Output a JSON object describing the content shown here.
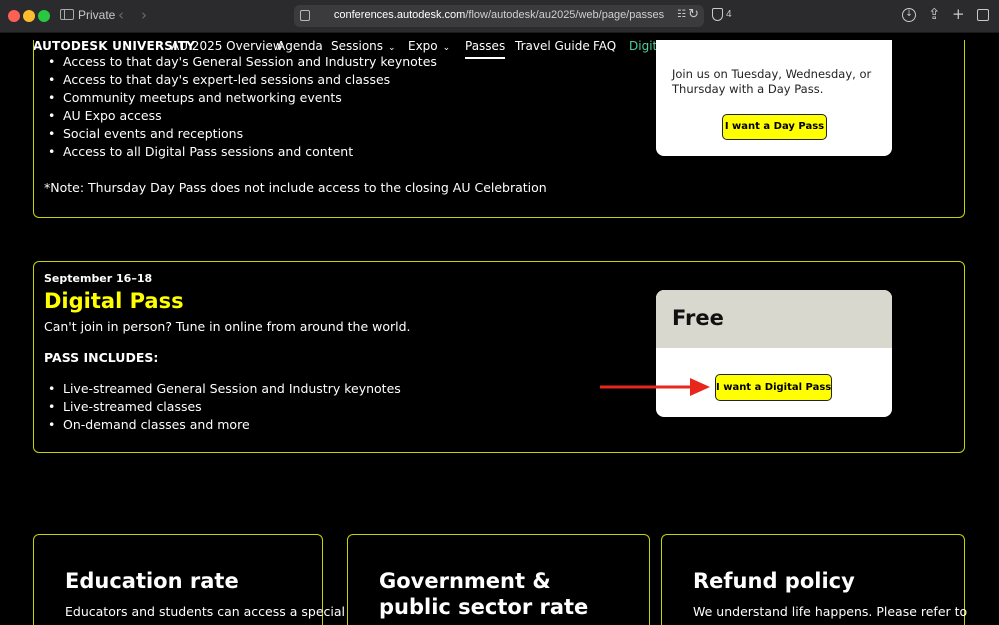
{
  "browser": {
    "private_label": "Private",
    "url_domain": "conferences.autodesk.com",
    "url_path": "/flow/autodesk/au2025/web/page/passes",
    "shield_count": "4"
  },
  "nav": {
    "brand": "AUTODESK UNIVERSITY",
    "items": [
      {
        "label": "AU 2025 Overview"
      },
      {
        "label": "Agenda"
      },
      {
        "label": "Sessions"
      },
      {
        "label": "Expo"
      },
      {
        "label": "Passes"
      },
      {
        "label": "Travel Guide"
      },
      {
        "label": "FAQ"
      },
      {
        "label": "Digital"
      }
    ],
    "chevron": "⌄",
    "active_color": "#ffffff",
    "digital_color": "#4fcf98"
  },
  "day_pass": {
    "bullets": [
      "Access to that day's General Session and Industry keynotes",
      "Access to that day's expert-led sessions and classes",
      "Community meetups and networking events",
      "AU Expo access",
      "Social events and receptions",
      "Access to all Digital Pass sessions and content"
    ],
    "note": "*Note: Thursday Day Pass does not include access to the closing AU Celebration",
    "card_text": "Join us on Tuesday, Wednesday, or Thursday with a Day Pass.",
    "button": "I want a Day Pass"
  },
  "digital_pass": {
    "dates": "September 16–18",
    "title": "Digital Pass",
    "subtitle": "Can't join in person? Tune in online from around the world.",
    "includes_label": "PASS INCLUDES:",
    "bullets": [
      "Live-streamed General Session and Industry keynotes",
      "Live-streamed classes",
      "On-demand classes and more"
    ],
    "price": "Free",
    "button": "I want a Digital Pass"
  },
  "bottom_cards": [
    {
      "title": "Education rate",
      "text": "Educators and students can access a special"
    },
    {
      "title": "Government & public sector rate",
      "text": ""
    },
    {
      "title": "Refund policy",
      "text": "We understand life happens. Please refer to"
    }
  ],
  "colors": {
    "accent_yellow": "#ffff00",
    "border_yellow": "#c8d400",
    "arrow_red": "#e8261b"
  }
}
